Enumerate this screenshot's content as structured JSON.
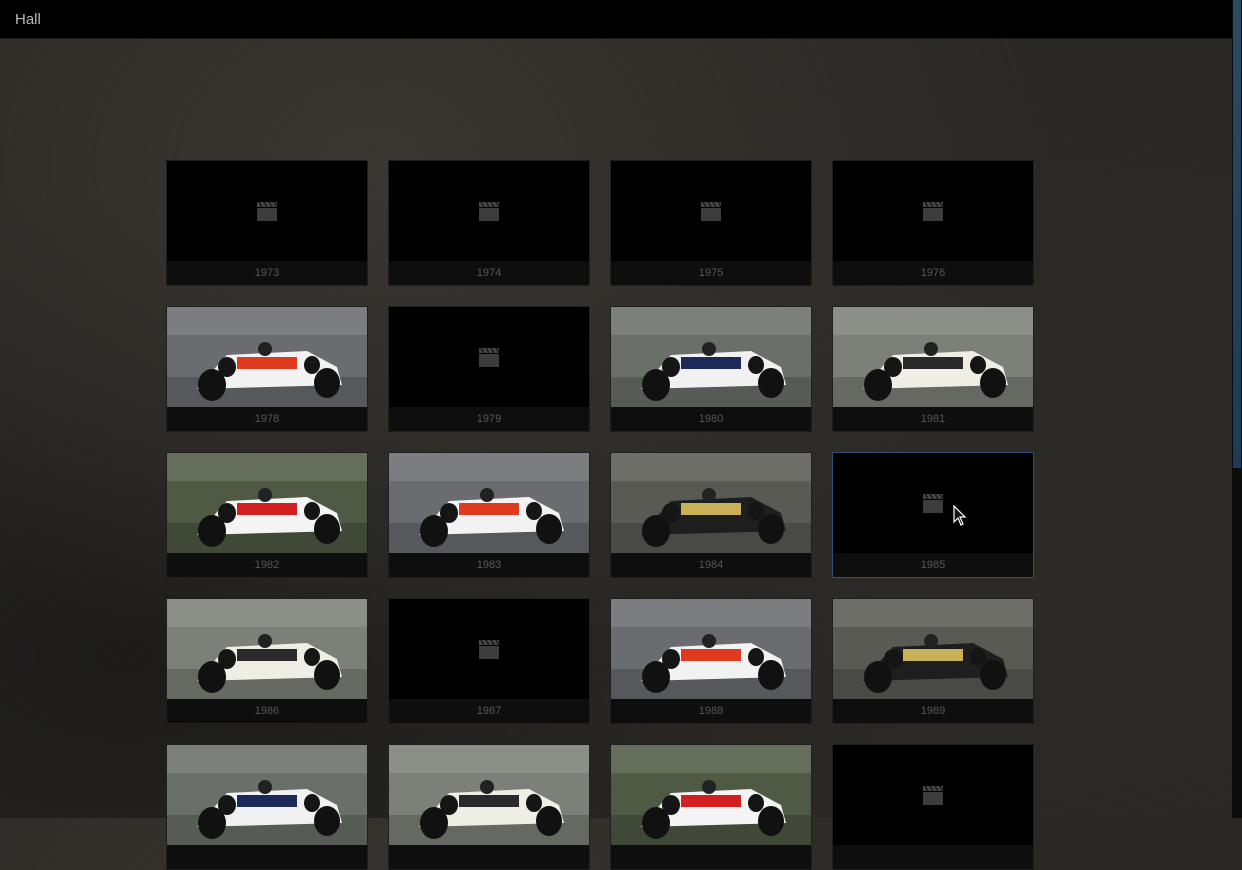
{
  "header": {
    "title": "Hall"
  },
  "tiles": [
    {
      "year": "1973",
      "thumb": "placeholder"
    },
    {
      "year": "1974",
      "thumb": "placeholder"
    },
    {
      "year": "1975",
      "thumb": "placeholder"
    },
    {
      "year": "1976",
      "thumb": "placeholder"
    },
    {
      "year": "1978",
      "thumb": "photo"
    },
    {
      "year": "1979",
      "thumb": "placeholder"
    },
    {
      "year": "1980",
      "thumb": "photo"
    },
    {
      "year": "1981",
      "thumb": "photo"
    },
    {
      "year": "1982",
      "thumb": "photo"
    },
    {
      "year": "1983",
      "thumb": "photo"
    },
    {
      "year": "1984",
      "thumb": "photo"
    },
    {
      "year": "1985",
      "thumb": "placeholder",
      "hovered": true
    },
    {
      "year": "1986",
      "thumb": "photo"
    },
    {
      "year": "1987",
      "thumb": "placeholder"
    },
    {
      "year": "1988",
      "thumb": "photo"
    },
    {
      "year": "1989",
      "thumb": "photo"
    },
    {
      "year": "",
      "thumb": "photo"
    },
    {
      "year": "",
      "thumb": "photo"
    },
    {
      "year": "",
      "thumb": "photo"
    },
    {
      "year": "",
      "thumb": "placeholder"
    }
  ],
  "theme": {
    "accent": "#2d4f73",
    "caption": "#575757"
  }
}
